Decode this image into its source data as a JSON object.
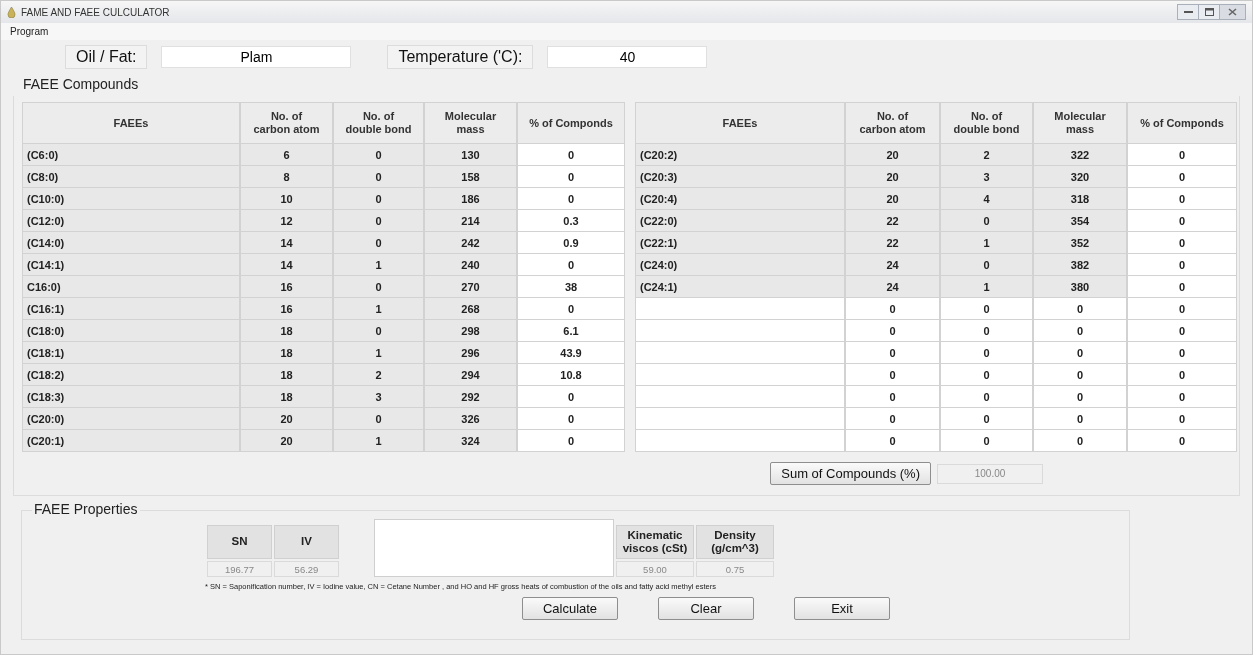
{
  "window": {
    "title": "FAME AND FAEE CULCULATOR"
  },
  "menu": [
    {
      "label": "Program"
    }
  ],
  "oil_fat": {
    "label": "Oil / Fat:",
    "value": "Plam"
  },
  "temperature": {
    "label": "Temperature ('C):",
    "value": "40"
  },
  "compounds": {
    "title": "FAEE Compounds",
    "tables": [
      {
        "columns": [
          "FAEEs",
          "No. of\ncarbon atom",
          "No. of\ndouble bond",
          "Molecular\nmass",
          "% of Componds"
        ],
        "rows": [
          {
            "kind": "compound",
            "name": "(C6:0)",
            "values": [
              "6",
              "0",
              "130"
            ],
            "percent": "0"
          },
          {
            "kind": "compound",
            "name": "(C8:0)",
            "values": [
              "8",
              "0",
              "158"
            ],
            "percent": "0"
          },
          {
            "kind": "compound",
            "name": "(C10:0)",
            "values": [
              "10",
              "0",
              "186"
            ],
            "percent": "0"
          },
          {
            "kind": "compound",
            "name": "(C12:0)",
            "values": [
              "12",
              "0",
              "214"
            ],
            "percent": "0.3"
          },
          {
            "kind": "compound",
            "name": "(C14:0)",
            "values": [
              "14",
              "0",
              "242"
            ],
            "percent": "0.9"
          },
          {
            "kind": "compound",
            "name": "(C14:1)",
            "values": [
              "14",
              "1",
              "240"
            ],
            "percent": "0"
          },
          {
            "kind": "compound",
            "name": "C16:0)",
            "values": [
              "16",
              "0",
              "270"
            ],
            "percent": "38"
          },
          {
            "kind": "compound",
            "name": "(C16:1)",
            "values": [
              "16",
              "1",
              "268"
            ],
            "percent": "0"
          },
          {
            "kind": "compound",
            "name": "(C18:0)",
            "values": [
              "18",
              "0",
              "298"
            ],
            "percent": "6.1"
          },
          {
            "kind": "compound",
            "name": "(C18:1)",
            "values": [
              "18",
              "1",
              "296"
            ],
            "percent": "43.9"
          },
          {
            "kind": "compound",
            "name": "(C18:2)",
            "values": [
              "18",
              "2",
              "294"
            ],
            "percent": "10.8"
          },
          {
            "kind": "compound",
            "name": "(C18:3)",
            "values": [
              "18",
              "3",
              "292"
            ],
            "percent": "0"
          },
          {
            "kind": "compound",
            "name": "(C20:0)",
            "values": [
              "20",
              "0",
              "326"
            ],
            "percent": "0"
          },
          {
            "kind": "compound",
            "name": "(C20:1)",
            "values": [
              "20",
              "1",
              "324"
            ],
            "percent": "0"
          }
        ]
      },
      {
        "columns": [
          "FAEEs",
          "No. of\ncarbon atom",
          "No. of\ndouble bond",
          "Molecular\nmass",
          "% of Componds"
        ],
        "rows": [
          {
            "kind": "compound",
            "name": "(C20:2)",
            "values": [
              "20",
              "2",
              "322"
            ],
            "percent": "0"
          },
          {
            "kind": "compound",
            "name": "(C20:3)",
            "values": [
              "20",
              "3",
              "320"
            ],
            "percent": "0"
          },
          {
            "kind": "compound",
            "name": "(C20:4)",
            "values": [
              "20",
              "4",
              "318"
            ],
            "percent": "0"
          },
          {
            "kind": "compound",
            "name": "(C22:0)",
            "values": [
              "22",
              "0",
              "354"
            ],
            "percent": "0"
          },
          {
            "kind": "compound",
            "name": "(C22:1)",
            "values": [
              "22",
              "1",
              "352"
            ],
            "percent": "0"
          },
          {
            "kind": "compound",
            "name": "(C24:0)",
            "values": [
              "24",
              "0",
              "382"
            ],
            "percent": "0"
          },
          {
            "kind": "compound",
            "name": "(C24:1)",
            "values": [
              "24",
              "1",
              "380"
            ],
            "percent": "0"
          },
          {
            "kind": "empty",
            "values": [
              "0",
              "0",
              "0"
            ],
            "percent": "0"
          },
          {
            "kind": "empty",
            "values": [
              "0",
              "0",
              "0"
            ],
            "percent": "0"
          },
          {
            "kind": "empty",
            "values": [
              "0",
              "0",
              "0"
            ],
            "percent": "0"
          },
          {
            "kind": "empty",
            "values": [
              "0",
              "0",
              "0"
            ],
            "percent": "0"
          },
          {
            "kind": "empty",
            "values": [
              "0",
              "0",
              "0"
            ],
            "percent": "0"
          },
          {
            "kind": "empty",
            "values": [
              "0",
              "0",
              "0"
            ],
            "percent": "0"
          },
          {
            "kind": "empty",
            "values": [
              "0",
              "0",
              "0"
            ],
            "percent": "0"
          }
        ]
      }
    ]
  },
  "sum": {
    "button": "Sum of Compounds (%)",
    "value": "100.00",
    "disabled": true
  },
  "properties": {
    "title": "FAEE Properties",
    "fields": [
      {
        "kind": "field",
        "label": "SN",
        "value": "196.77",
        "disabled": true
      },
      {
        "kind": "field",
        "label": "IV",
        "value": "56.29",
        "disabled": true
      },
      {
        "kind": "blank"
      },
      {
        "kind": "field",
        "label": "Kinematic\nviscos (cSt)",
        "value": "59.00",
        "disabled": true
      },
      {
        "kind": "field",
        "label": "Density\n(g/cm^3)",
        "value": "0.75",
        "disabled": true
      }
    ],
    "note": "* SN = Saponification number, IV = Iodine value, CN = Cetane Number , and HO and HF gross heats of combustion of the oils and fatty  acid  methyl esters",
    "buttons": [
      "Calculate",
      "Clear",
      "Exit"
    ]
  }
}
